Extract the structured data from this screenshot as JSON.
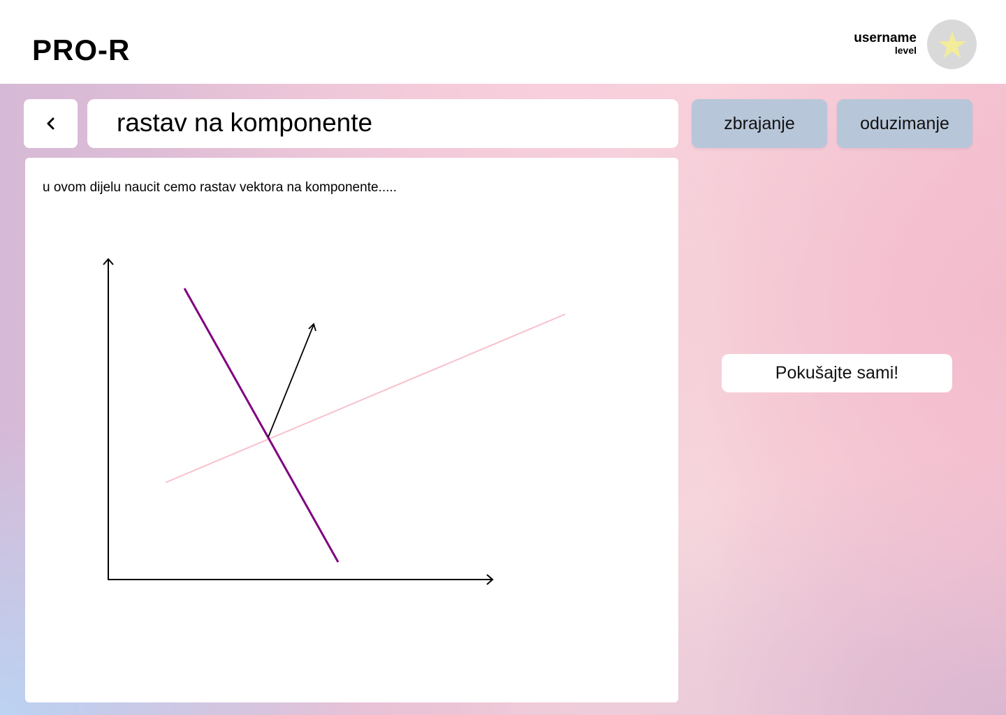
{
  "app": {
    "brand": "PRO-R"
  },
  "user": {
    "name": "username",
    "level": "level",
    "avatar_icon": "star-icon",
    "avatar_color": "#d9d9d9",
    "star_color": "#f2ec9b"
  },
  "header": {
    "back_icon": "chevron-left-icon",
    "title": "rastav na komponente"
  },
  "tabs": [
    {
      "label": "zbrajanje"
    },
    {
      "label": "oduzimanje"
    }
  ],
  "lesson": {
    "intro": "u ovom dijelu naucit cemo rastav vektora na komponente.....",
    "diagram": {
      "axis_color": "#000000",
      "vector_color": "#000000",
      "line_1_color": "#800080",
      "line_2_color": "#f7c1cc"
    }
  },
  "actions": {
    "try_label": "Pokušajte sami!"
  },
  "colors": {
    "tab_background": "#b8c6d9",
    "card_background": "#ffffff"
  }
}
